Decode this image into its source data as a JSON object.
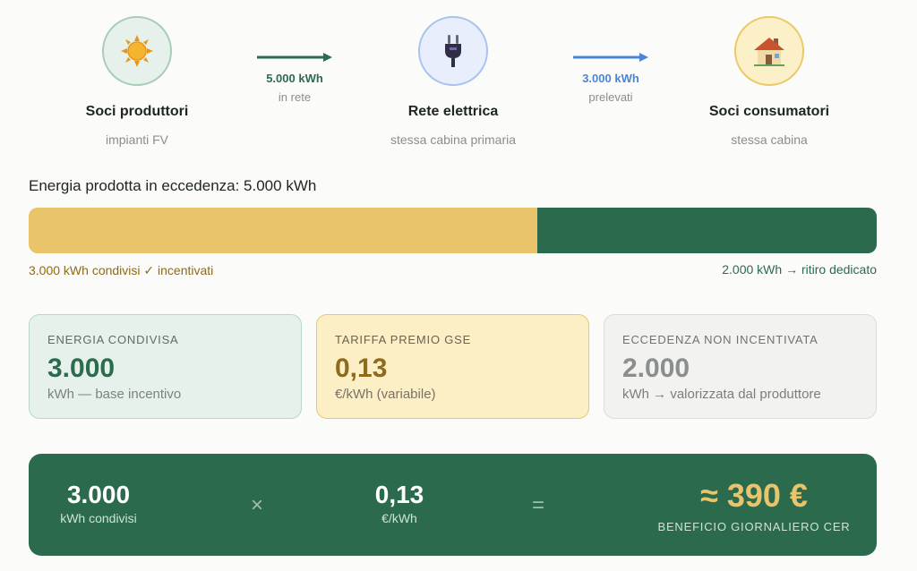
{
  "flow": {
    "producers": {
      "title": "Soci produttori",
      "sub": "impianti FV",
      "icon": "sun-icon"
    },
    "to_grid": {
      "value": "5.000 kWh",
      "label": "in rete"
    },
    "grid": {
      "title": "Rete elettrica",
      "sub": "stessa cabina primaria",
      "icon": "plug-icon"
    },
    "from_grid": {
      "value": "3.000 kWh",
      "label": "prelevati"
    },
    "consumers": {
      "title": "Soci consumatori",
      "sub": "stessa cabina",
      "icon": "house-icon"
    }
  },
  "excess": {
    "title": "Energia prodotta in eccedenza: 5.000 kWh",
    "shared_fraction": 0.6,
    "shared_label": "3.000 kWh condivisi ✓ incentivati",
    "withdrawn_label": "2.000 kWh → ritiro dedicato"
  },
  "cards": [
    {
      "label": "ENERGIA CONDIVISA",
      "value": "3.000",
      "unit": "kWh — base incentivo"
    },
    {
      "label": "TARIFFA PREMIO GSE",
      "value": "0,13",
      "unit": "€/kWh (variabile)"
    },
    {
      "label": "ECCEDENZA NON INCENTIVATA",
      "value": "2.000",
      "unit": "kWh → valorizzata dal produttore"
    }
  ],
  "formula": {
    "term1": {
      "value": "3.000",
      "unit": "kWh condivisi"
    },
    "times": "×",
    "term2": {
      "value": "0,13",
      "unit": "€/kWh"
    },
    "equals": "=",
    "result": {
      "value": "≈ 390 €",
      "label": "BENEFICIO GIORNALIERO CER"
    }
  },
  "colors": {
    "green": "#2c6a4e",
    "gold": "#e9c46a",
    "blue": "#4a86d8"
  }
}
